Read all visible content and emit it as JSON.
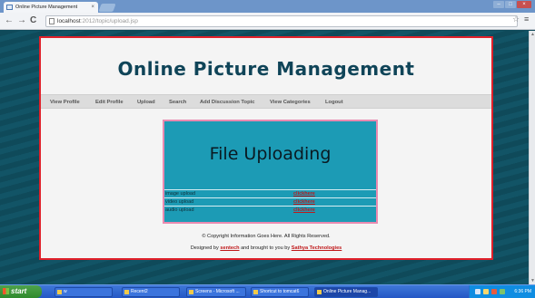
{
  "browser": {
    "tab_title": "Online Picture Management",
    "tab_close": "×",
    "url_host": "localhost",
    "url_path": ":2012/topic/upload.jsp",
    "back": "←",
    "forward": "→",
    "reload": "C",
    "star": "☆",
    "menu": "≡"
  },
  "site": {
    "title": "Online Picture Management",
    "nav": [
      "View Profile",
      "Edit Profile",
      "Upload",
      "Search",
      "Add Discussion Topic",
      "View Categories",
      "Logout"
    ],
    "upload_heading": "File Uploading",
    "uploads": [
      {
        "label": "image upload",
        "link": "clickhere"
      },
      {
        "label": "video upload",
        "link": "clickhere"
      },
      {
        "label": "audio upload",
        "link": "clickhere"
      }
    ],
    "footer_copyright": "© Copyright Information Goes Here. All Rights Reserved.",
    "footer_designed_prefix": "Designed by",
    "footer_designer": "sentech",
    "footer_middle": "and brought to you by",
    "footer_company": "Sathya Technologies"
  },
  "taskbar": {
    "start": "start",
    "tasks": [
      "w",
      "Recent2",
      "Screens - Microsoft ...",
      "Shortcut to tomcat6",
      "Online Picture Manag..."
    ],
    "clock": "6:36 PM"
  },
  "colors": {
    "page_bg": "#0f4a5a",
    "frame_border": "#e0202a",
    "title_color": "#0f4458",
    "upload_bg": "#1c9bb5",
    "link_red": "#c0181a"
  }
}
